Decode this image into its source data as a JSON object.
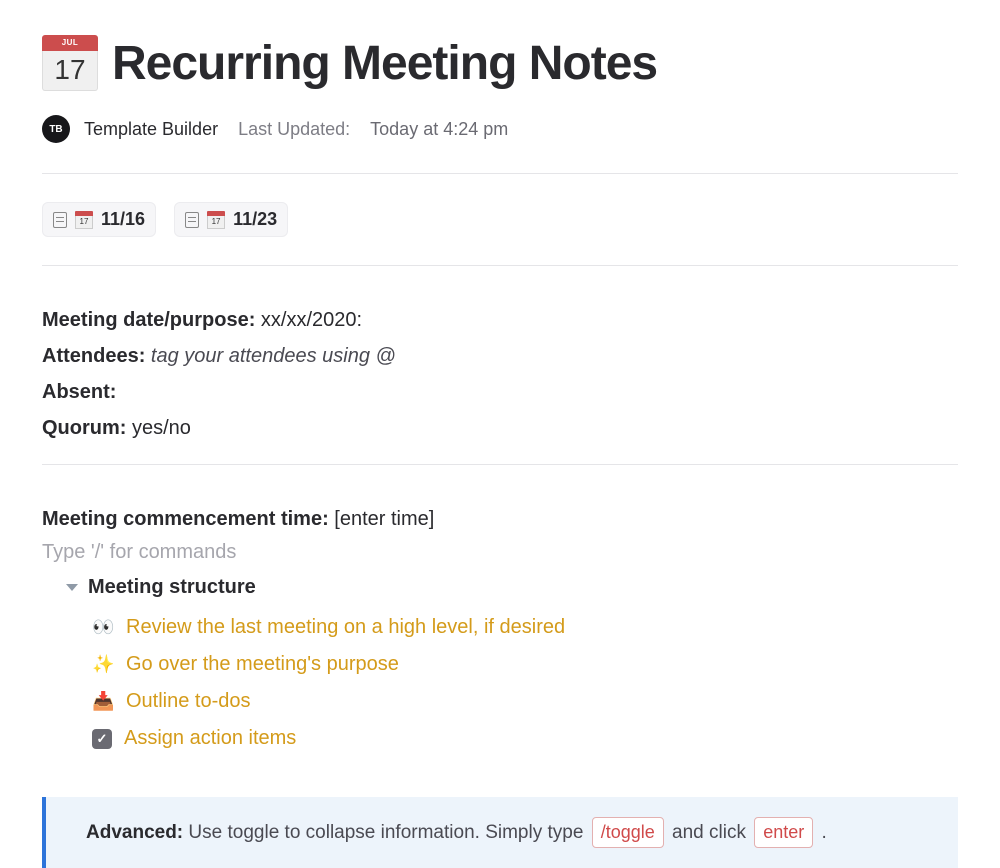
{
  "header": {
    "icon_month": "JUL",
    "icon_day": "17",
    "title": "Recurring Meeting Notes"
  },
  "meta": {
    "avatar_initials": "TB",
    "author": "Template Builder",
    "last_updated_label": "Last Updated:",
    "last_updated_value": "Today at 4:24 pm"
  },
  "subpages": [
    {
      "icon_day": "17",
      "label": "11/16"
    },
    {
      "icon_day": "17",
      "label": "11/23"
    }
  ],
  "details": {
    "date_label": "Meeting date/purpose:",
    "date_value": "xx/xx/2020:",
    "attendees_label": "Attendees:",
    "attendees_value": "tag your attendees using @",
    "absent_label": "Absent:",
    "quorum_label": "Quorum:",
    "quorum_value": "yes/no"
  },
  "commence": {
    "label": "Meeting commencement time:",
    "value": "[enter time]",
    "placeholder": "Type '/' for commands"
  },
  "structure": {
    "title": "Meeting structure",
    "items": [
      {
        "emoji": "👀",
        "text": "Review the last meeting on a high level, if desired"
      },
      {
        "emoji": "✨",
        "text": "Go over the meeting's purpose"
      },
      {
        "emoji": "📥",
        "text": "Outline to-dos"
      },
      {
        "emoji": "checkbox",
        "text": "Assign action items"
      }
    ]
  },
  "callout": {
    "bold": "Advanced:",
    "text_1": "Use toggle to collapse information. Simply type",
    "code_1": "/toggle",
    "text_2": "and click",
    "code_2": "enter",
    "text_3": "."
  }
}
